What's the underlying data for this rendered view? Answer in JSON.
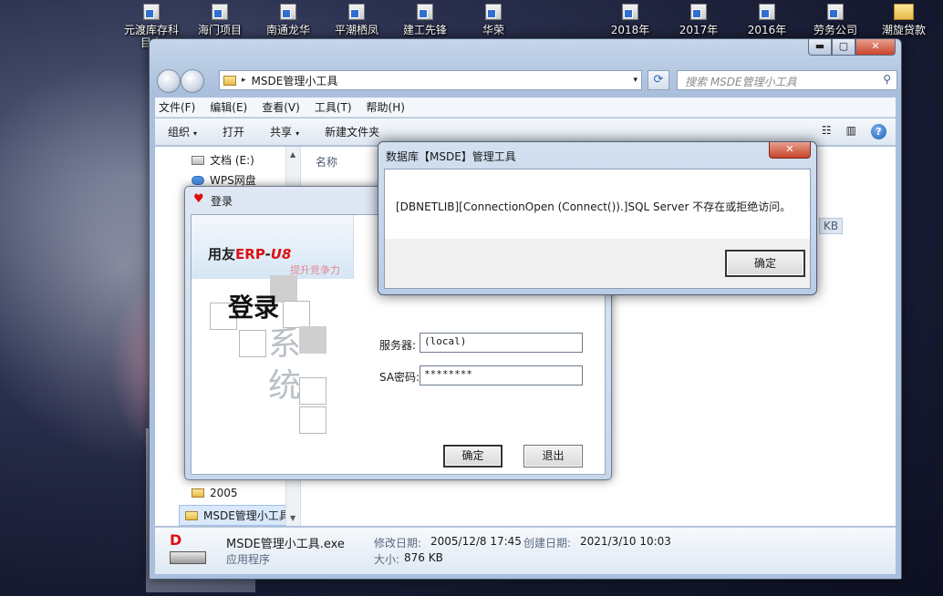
{
  "desktop": {
    "icons": [
      {
        "label": "元渡库存科目余",
        "type": "shortcut"
      },
      {
        "label": "海门项目",
        "type": "shortcut"
      },
      {
        "label": "南通龙华",
        "type": "shortcut"
      },
      {
        "label": "平潮栖凤",
        "type": "shortcut"
      },
      {
        "label": "建工先锋",
        "type": "shortcut"
      },
      {
        "label": "华荣",
        "type": "shortcut"
      },
      {
        "label": "2018年",
        "type": "shortcut"
      },
      {
        "label": "2017年",
        "type": "shortcut"
      },
      {
        "label": "2016年",
        "type": "shortcut"
      },
      {
        "label": "劳务公司",
        "type": "shortcut"
      },
      {
        "label": "潮旋贷款",
        "type": "folder"
      }
    ]
  },
  "explorer": {
    "controls": {
      "minimize": "▬",
      "maximize": "▢",
      "close": "✕"
    },
    "address": {
      "sep": "▸",
      "path": "MSDE管理小工具",
      "drop": "▾"
    },
    "refresh_glyph": "⟳",
    "search": {
      "placeholder": "搜索 MSDE管理小工具",
      "icon": "⚲"
    },
    "menu": [
      "文件(F)",
      "编辑(E)",
      "查看(V)",
      "工具(T)",
      "帮助(H)"
    ],
    "toolbar": {
      "organize": "组织",
      "open": "打开",
      "share": "共享",
      "new_folder": "新建文件夹",
      "caret": "▾",
      "view_icon": "☷",
      "pane_icon": "▥",
      "help_glyph": "?"
    },
    "nav": {
      "items": [
        {
          "label": "文档 (E:)",
          "icon": "drive"
        },
        {
          "label": "WPS网盘",
          "icon": "cloud"
        },
        {
          "label": "2005",
          "icon": "folder"
        },
        {
          "label": "MSDE管理小工具",
          "icon": "folder"
        }
      ],
      "scroll_up": "▲",
      "scroll_down": "▼"
    },
    "column_name": "名称",
    "size_fragment": "KB",
    "details": {
      "icon_letter": "D",
      "name": "MSDE管理小工具.exe",
      "modified_label": "修改日期:",
      "modified": "2005/12/8 17:45",
      "created_label": "创建日期:",
      "created": "2021/3/10 10:03",
      "type": "应用程序",
      "size_label": "大小:",
      "size": "876 KB"
    }
  },
  "login": {
    "heart_glyph": "♥",
    "title": "登录",
    "logo": {
      "prefix": "用友",
      "erp": "ERP",
      "dash": "-",
      "u8": "U8"
    },
    "slogan": "提升竞争力",
    "big_login": "登录",
    "big_sys_1": "系",
    "big_sys_2": "统",
    "server_label": "服务器:",
    "server_value": "(local)",
    "password_label": "SA密码:",
    "password_value": "********",
    "ok": "确定",
    "exit": "退出"
  },
  "dialog": {
    "title": "数据库【MSDE】管理工具",
    "close": "✕",
    "message": "[DBNETLIB][ConnectionOpen (Connect()).]SQL Server 不存在或拒绝访问。",
    "ok": "确定"
  }
}
